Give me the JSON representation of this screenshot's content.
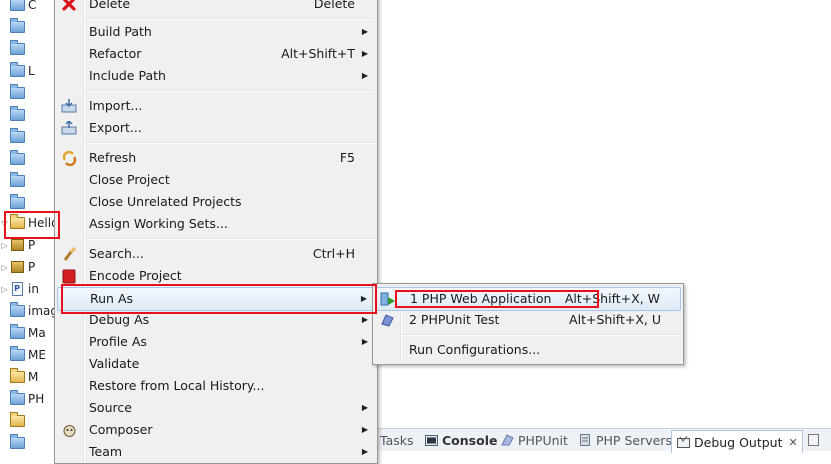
{
  "tree": {
    "rows": [
      {
        "label": "C",
        "icon": "folder",
        "twisty": ""
      },
      {
        "label": "",
        "icon": "folder",
        "twisty": ""
      },
      {
        "label": "",
        "icon": "folder",
        "twisty": ""
      },
      {
        "label": "L",
        "icon": "folder",
        "twisty": ""
      },
      {
        "label": "",
        "icon": "folder",
        "twisty": ""
      },
      {
        "label": "",
        "icon": "folder",
        "twisty": ""
      },
      {
        "label": "",
        "icon": "folder",
        "twisty": ""
      },
      {
        "label": "",
        "icon": "folder",
        "twisty": ""
      },
      {
        "label": "",
        "icon": "folder",
        "twisty": ""
      },
      {
        "label": "",
        "icon": "folder",
        "twisty": ""
      },
      {
        "label": "Hello",
        "icon": "folder-open",
        "twisty": "▽"
      },
      {
        "label": "P",
        "icon": "package",
        "twisty": "▷"
      },
      {
        "label": "P",
        "icon": "package",
        "twisty": "▷"
      },
      {
        "label": "in",
        "icon": "php-file",
        "twisty": "▷"
      },
      {
        "label": "imag",
        "icon": "folder",
        "twisty": ""
      },
      {
        "label": "Ma",
        "icon": "folder",
        "twisty": ""
      },
      {
        "label": "ME",
        "icon": "folder",
        "twisty": ""
      },
      {
        "label": "M",
        "icon": "folder-open",
        "twisty": ""
      },
      {
        "label": "PH",
        "icon": "folder",
        "twisty": ""
      },
      {
        "label": "",
        "icon": "folder-open",
        "twisty": ""
      },
      {
        "label": "",
        "icon": "folder",
        "twisty": ""
      }
    ]
  },
  "context_menu": {
    "items": [
      {
        "label": "Delete",
        "accel": "Delete",
        "icon": "delete-icon",
        "arrow": false
      },
      {
        "label": "Build Path",
        "accel": "",
        "icon": "",
        "arrow": true
      },
      {
        "label": "Refactor",
        "accel": "Alt+Shift+T",
        "icon": "",
        "arrow": true
      },
      {
        "label": "Include Path",
        "accel": "",
        "icon": "",
        "arrow": true
      },
      {
        "label": "Import...",
        "accel": "",
        "icon": "import-icon",
        "arrow": false
      },
      {
        "label": "Export...",
        "accel": "",
        "icon": "export-icon",
        "arrow": false
      },
      {
        "label": "Refresh",
        "accel": "F5",
        "icon": "refresh-icon",
        "arrow": false
      },
      {
        "label": "Close Project",
        "accel": "",
        "icon": "",
        "arrow": false
      },
      {
        "label": "Close Unrelated Projects",
        "accel": "",
        "icon": "",
        "arrow": false
      },
      {
        "label": "Assign Working Sets...",
        "accel": "",
        "icon": "",
        "arrow": false
      },
      {
        "label": "Search...",
        "accel": "Ctrl+H",
        "icon": "search-icon",
        "arrow": false
      },
      {
        "label": "Encode Project",
        "accel": "",
        "icon": "encode-icon",
        "arrow": false
      },
      {
        "label": "Run As",
        "accel": "",
        "icon": "",
        "arrow": true
      },
      {
        "label": "Debug As",
        "accel": "",
        "icon": "",
        "arrow": true
      },
      {
        "label": "Profile As",
        "accel": "",
        "icon": "",
        "arrow": true
      },
      {
        "label": "Validate",
        "accel": "",
        "icon": "",
        "arrow": false
      },
      {
        "label": "Restore from Local History...",
        "accel": "",
        "icon": "",
        "arrow": false
      },
      {
        "label": "Source",
        "accel": "",
        "icon": "",
        "arrow": true
      },
      {
        "label": "Composer",
        "accel": "",
        "icon": "composer-icon",
        "arrow": true
      },
      {
        "label": "Team",
        "accel": "",
        "icon": "",
        "arrow": true
      }
    ]
  },
  "run_as_menu": {
    "items": [
      {
        "label": "1 PHP Web Application",
        "accel": "Alt+Shift+X, W",
        "icon": "php-web-run-icon"
      },
      {
        "label": "2 PHPUnit Test",
        "accel": "Alt+Shift+X, U",
        "icon": "phpunit-icon"
      },
      {
        "label": "Run Configurations...",
        "accel": "",
        "icon": ""
      }
    ]
  },
  "bottom_tabs": [
    {
      "label": "Tasks",
      "icon": "tasks-icon",
      "active": false
    },
    {
      "label": "Console",
      "icon": "console-icon",
      "active": false
    },
    {
      "label": "PHPUnit",
      "icon": "phpunit-tab-icon",
      "active": false
    },
    {
      "label": "PHP Servers",
      "icon": "servers-icon",
      "active": false
    },
    {
      "label": "Debug Output",
      "icon": "debug-output-icon",
      "active": true
    },
    {
      "label": "",
      "icon": "browser-output-icon",
      "active": false
    }
  ],
  "colors": {
    "highlight_red": "#e8101a",
    "menu_bg": "#f0f0f0",
    "hover_blue": "#dfeaf8"
  }
}
